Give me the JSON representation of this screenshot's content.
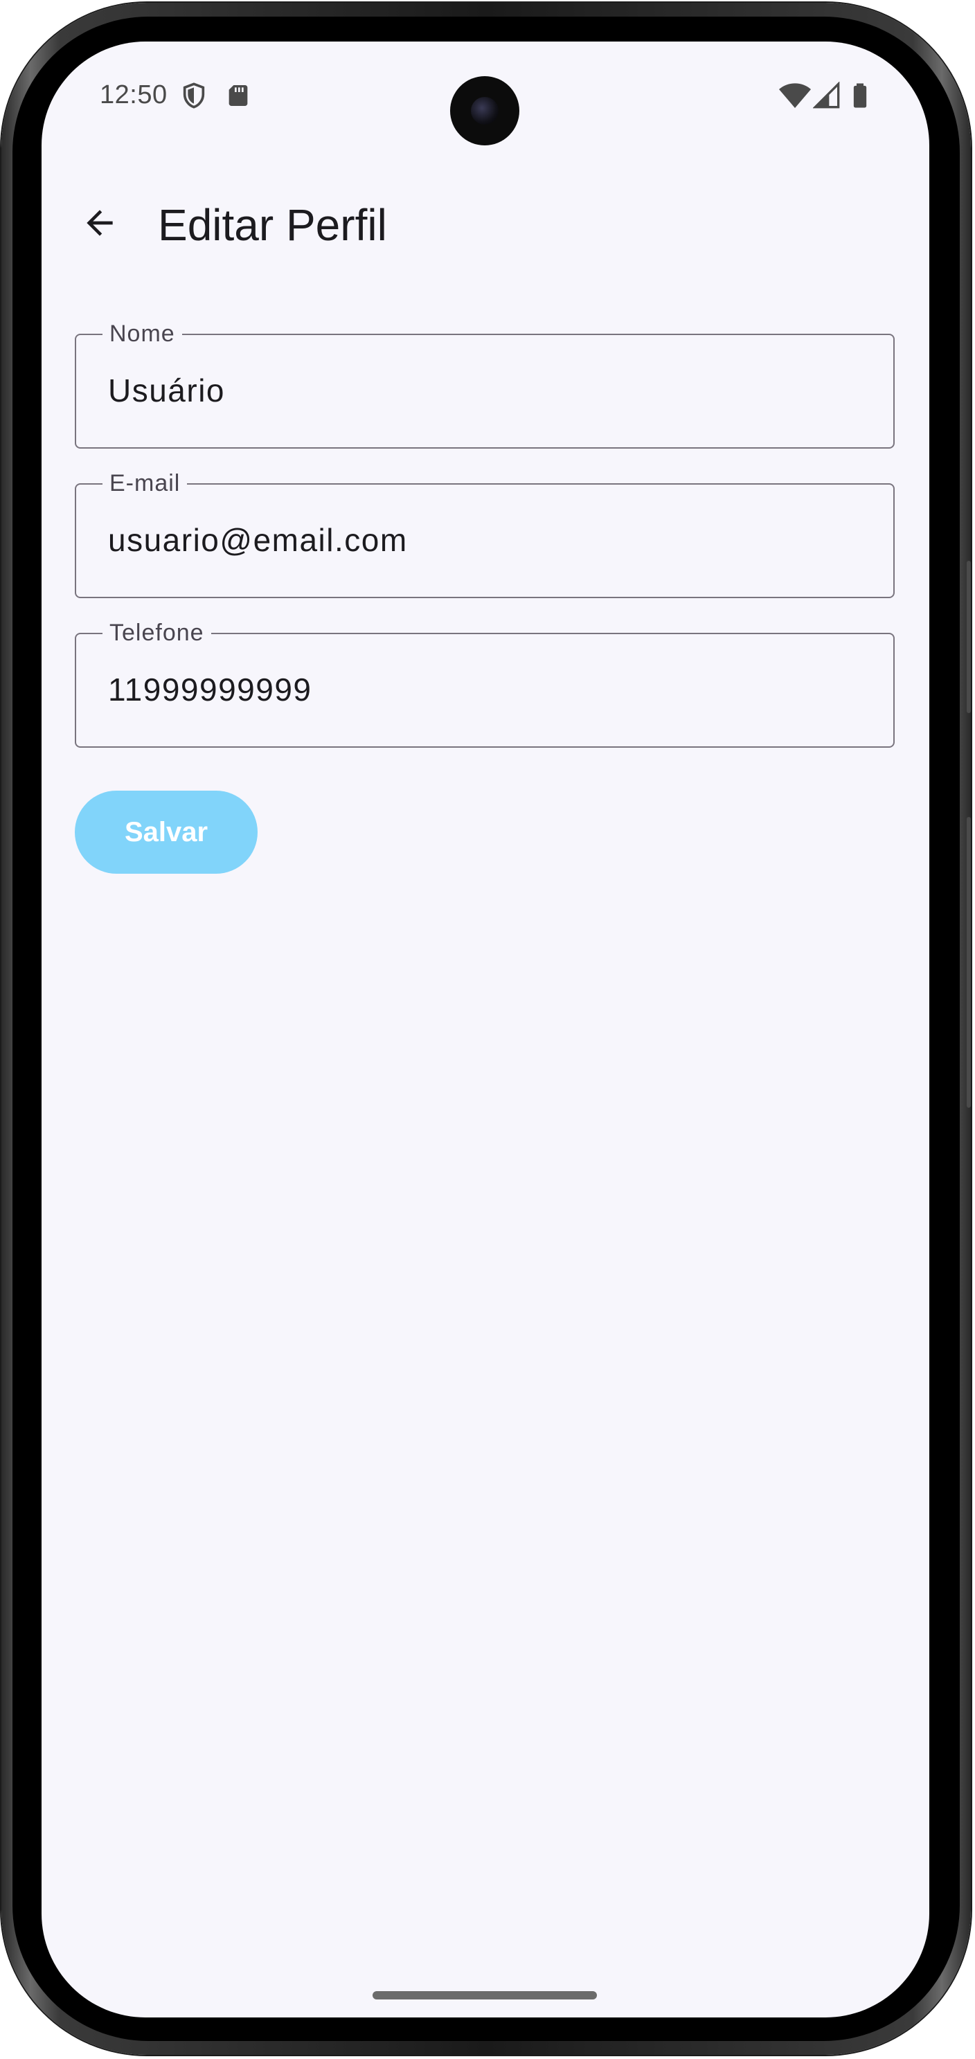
{
  "status_bar": {
    "time": "12:50",
    "left_icons": [
      "shield-icon",
      "sd-card-icon"
    ],
    "right_icons": [
      "wifi-icon",
      "signal-icon",
      "battery-icon"
    ]
  },
  "app_bar": {
    "back_icon": "arrow-back-icon",
    "title": "Editar Perfil"
  },
  "form": {
    "name": {
      "label": "Nome",
      "value": "Usuário"
    },
    "email": {
      "label": "E-mail",
      "value": "usuario@email.com"
    },
    "phone": {
      "label": "Telefone",
      "value": "11999999999"
    }
  },
  "actions": {
    "save_label": "Salvar"
  },
  "colors": {
    "background": "#f7f6fc",
    "field_border": "#79747e",
    "button": "#81d4fa",
    "button_text": "#ffffff",
    "text_primary": "#1c1b1f"
  }
}
